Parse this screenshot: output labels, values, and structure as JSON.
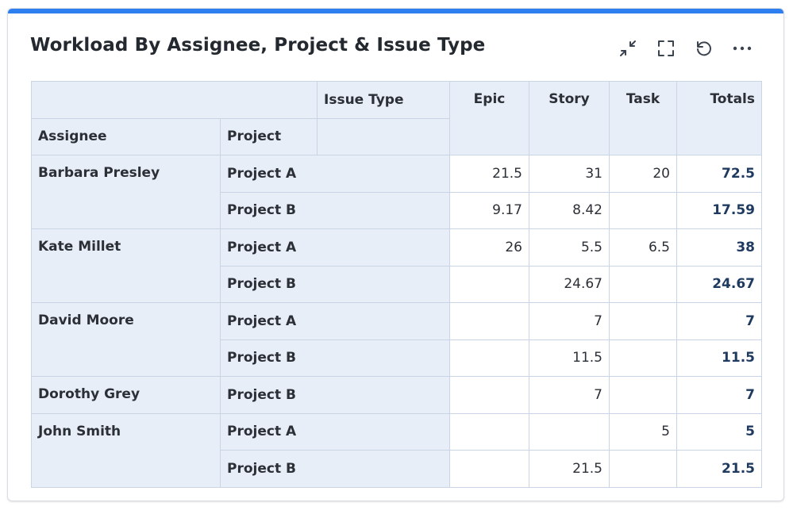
{
  "widget": {
    "title": "Workload By Assignee, Project & Issue Type",
    "accent_color": "#2d7ff0",
    "toolbar": [
      {
        "name": "collapse-icon"
      },
      {
        "name": "fullscreen-icon"
      },
      {
        "name": "refresh-icon"
      },
      {
        "name": "more-options-icon"
      }
    ]
  },
  "table": {
    "headers": {
      "issue_type": "Issue Type",
      "assignee": "Assignee",
      "project": "Project",
      "epic": "Epic",
      "story": "Story",
      "task": "Task",
      "totals": "Totals"
    },
    "rows": [
      {
        "assignee": "Barbara Presley",
        "project": "Project A",
        "epic": "21.5",
        "story": "31",
        "task": "20",
        "total": "72.5"
      },
      {
        "assignee": "Barbara Presley",
        "project": "Project B",
        "epic": "9.17",
        "story": "8.42",
        "task": "",
        "total": "17.59"
      },
      {
        "assignee": "Kate Millet",
        "project": "Project A",
        "epic": "26",
        "story": "5.5",
        "task": "6.5",
        "total": "38"
      },
      {
        "assignee": "Kate Millet",
        "project": "Project B",
        "epic": "",
        "story": "24.67",
        "task": "",
        "total": "24.67"
      },
      {
        "assignee": "David Moore",
        "project": "Project A",
        "epic": "",
        "story": "7",
        "task": "",
        "total": "7"
      },
      {
        "assignee": "David Moore",
        "project": "Project B",
        "epic": "",
        "story": "11.5",
        "task": "",
        "total": "11.5"
      },
      {
        "assignee": "Dorothy Grey",
        "project": "Project B",
        "epic": "",
        "story": "7",
        "task": "",
        "total": "7"
      },
      {
        "assignee": "John Smith",
        "project": "Project A",
        "epic": "",
        "story": "",
        "task": "5",
        "total": "5"
      },
      {
        "assignee": "John Smith",
        "project": "Project B",
        "epic": "",
        "story": "21.5",
        "task": "",
        "total": "21.5"
      }
    ]
  }
}
